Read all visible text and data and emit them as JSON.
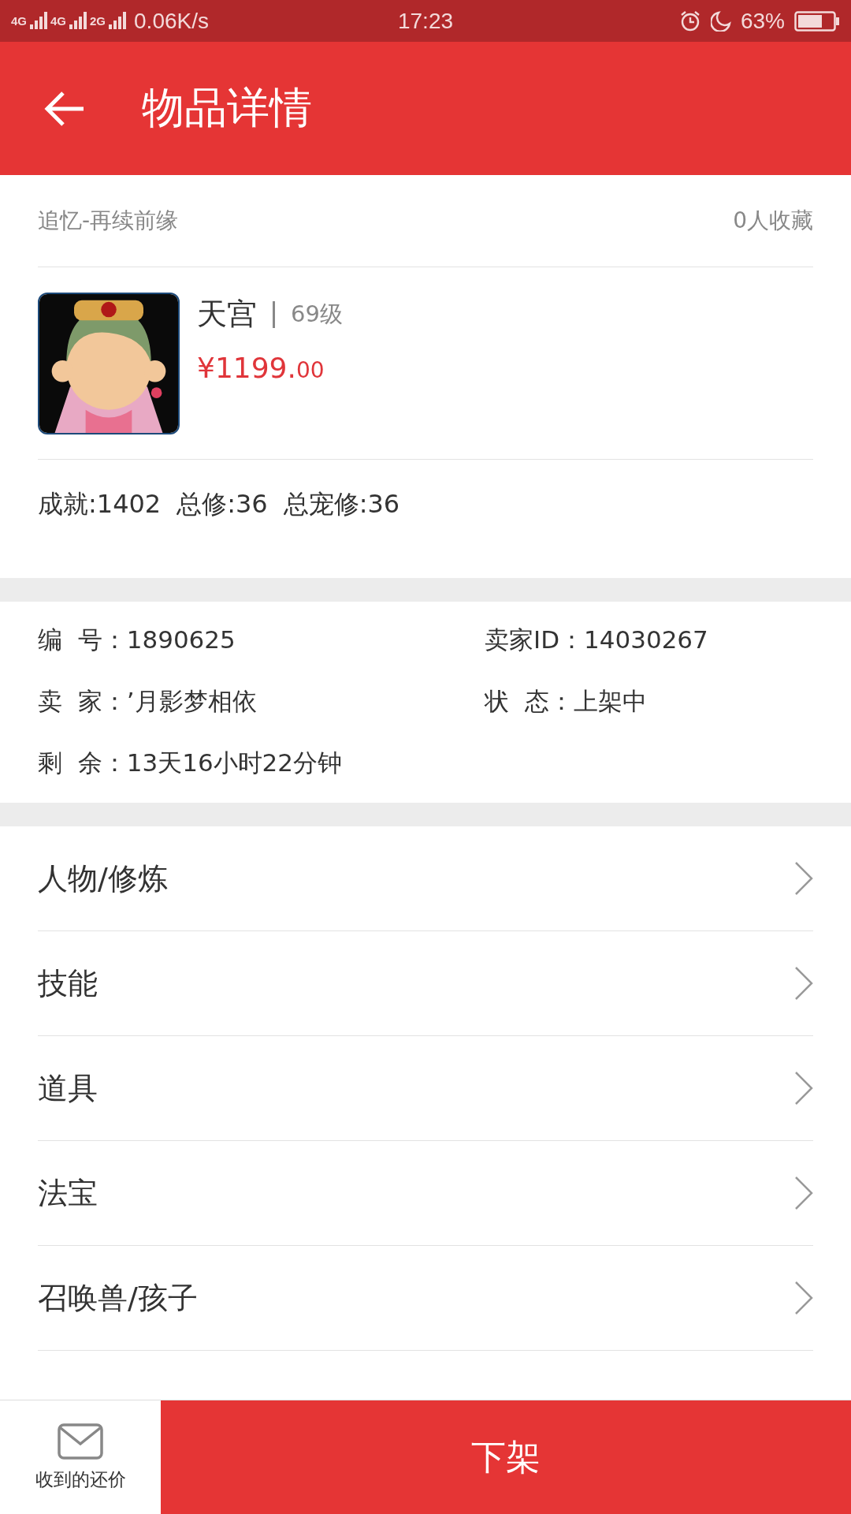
{
  "status_bar": {
    "networks": [
      "4G",
      "4G",
      "2G"
    ],
    "speed": "0.06K/s",
    "time": "17:23",
    "battery": "63%"
  },
  "app_bar": {
    "title": "物品详情"
  },
  "summary": {
    "server": "追忆-再续前缘",
    "favorites": "0人收藏",
    "name": "天宫",
    "level": "69级",
    "price_main": "¥1199.",
    "price_cents": "00",
    "stats": [
      "成就:1402",
      "总修:36",
      "总宠修:36"
    ]
  },
  "info": [
    "编  号：1890625",
    "卖家ID：14030267",
    "卖  家：’月影梦相依",
    "状  态：上架中",
    "剩  余：13天16小时22分钟"
  ],
  "menu": [
    "人物/修炼",
    "技能",
    "道具",
    "法宝",
    "召唤兽/孩子"
  ],
  "bottom_bar": {
    "offers": "收到的还价",
    "action": "下架"
  }
}
